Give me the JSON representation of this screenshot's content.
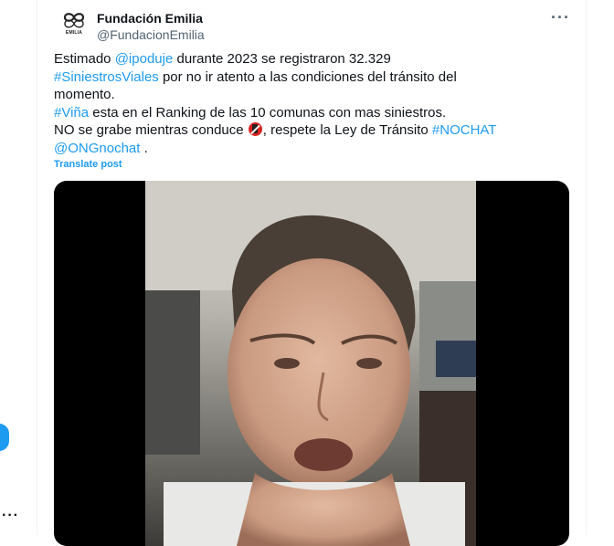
{
  "author": {
    "display_name": "Fundación Emilia",
    "handle": "@FundacionEmilia",
    "avatar_text": "EMILIA"
  },
  "tweet": {
    "line1": {
      "t1": "Estimado ",
      "mention": "@ipoduje",
      "t2": " durante 2023 se registraron 32.329"
    },
    "line2": {
      "hashtag": "#SiniestrosViales",
      "t1": " por no ir atento a las condiciones del tránsito del"
    },
    "line3": {
      "t1": "momento."
    },
    "line4": {
      "hashtag": "#Viña",
      "t1": " esta en el Ranking de las 10 comunas con mas siniestros."
    },
    "line5": {
      "t1": "NO se grabe mientras conduce ",
      "emoji_icon": "no-mobile-phones-icon",
      "t2": ", respete la Ley de Tránsito ",
      "hashtag": "#NOCHAT"
    },
    "line6": {
      "mention": "@ONGnochat",
      "t1": " ."
    }
  },
  "translate_label": "Translate post",
  "more_label": "···",
  "rail_more_label": "···",
  "colors": {
    "link": "#1d9bf0",
    "text": "#0f1419",
    "muted": "#536471"
  }
}
